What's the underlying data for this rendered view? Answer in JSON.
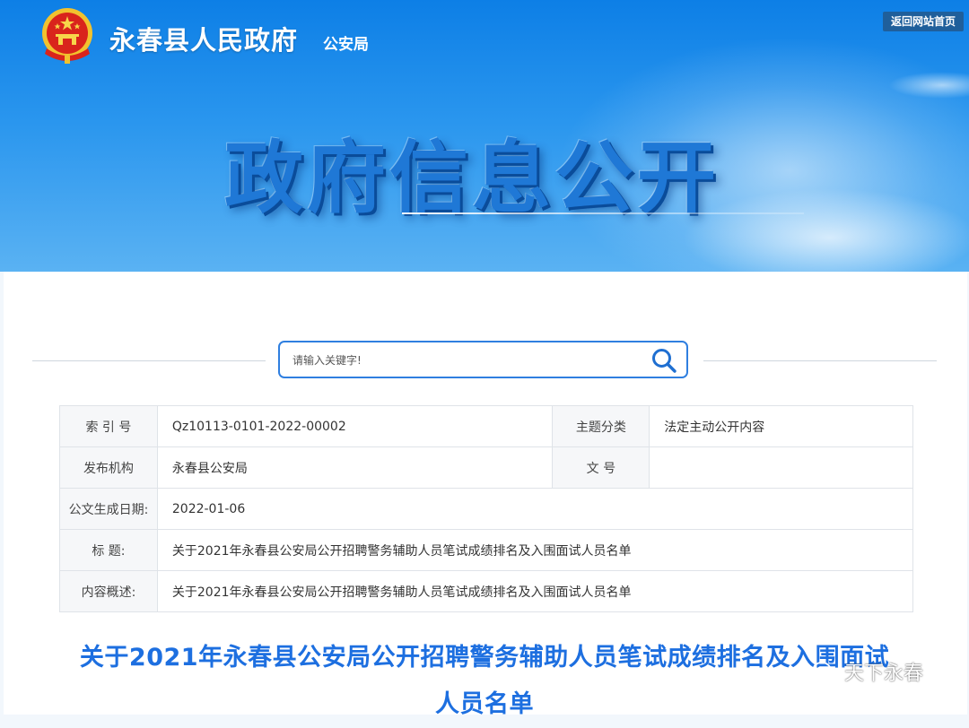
{
  "header": {
    "site_name": "永春县人民政府",
    "department": "公安局",
    "home_link": "返回网站首页",
    "banner_title": "政府信息公开"
  },
  "search": {
    "placeholder": "请输入关键字!",
    "icon": "search-icon"
  },
  "meta_table": {
    "index_label": "索 引 号",
    "index_value": "Qz10113-0101-2022-00002",
    "category_label": "主题分类",
    "category_value": "法定主动公开内容",
    "publisher_label": "发布机构",
    "publisher_value": "永春县公安局",
    "doc_no_label": "文 号",
    "doc_no_value": "",
    "date_label": "公文生成日期:",
    "date_value": "2022-01-06",
    "title_label": "标 题:",
    "title_value": "关于2021年永春县公安局公开招聘警务辅助人员笔试成绩排名及入围面试人员名单",
    "summary_label": "内容概述:",
    "summary_value": "关于2021年永春县公安局公开招聘警务辅助人员笔试成绩排名及入围面试人员名单"
  },
  "document": {
    "title_line1": "关于2021年永春县公安局公开招聘警务辅助人员笔试成绩排名及入围面试",
    "title_line2": "人员名单"
  },
  "watermark": {
    "text": "天下永春",
    "icon": "wechat-icon"
  },
  "colors": {
    "banner_blue": "#1f78d6",
    "accent_blue": "#1d6fe0",
    "home_button": "#1f5f9b"
  }
}
